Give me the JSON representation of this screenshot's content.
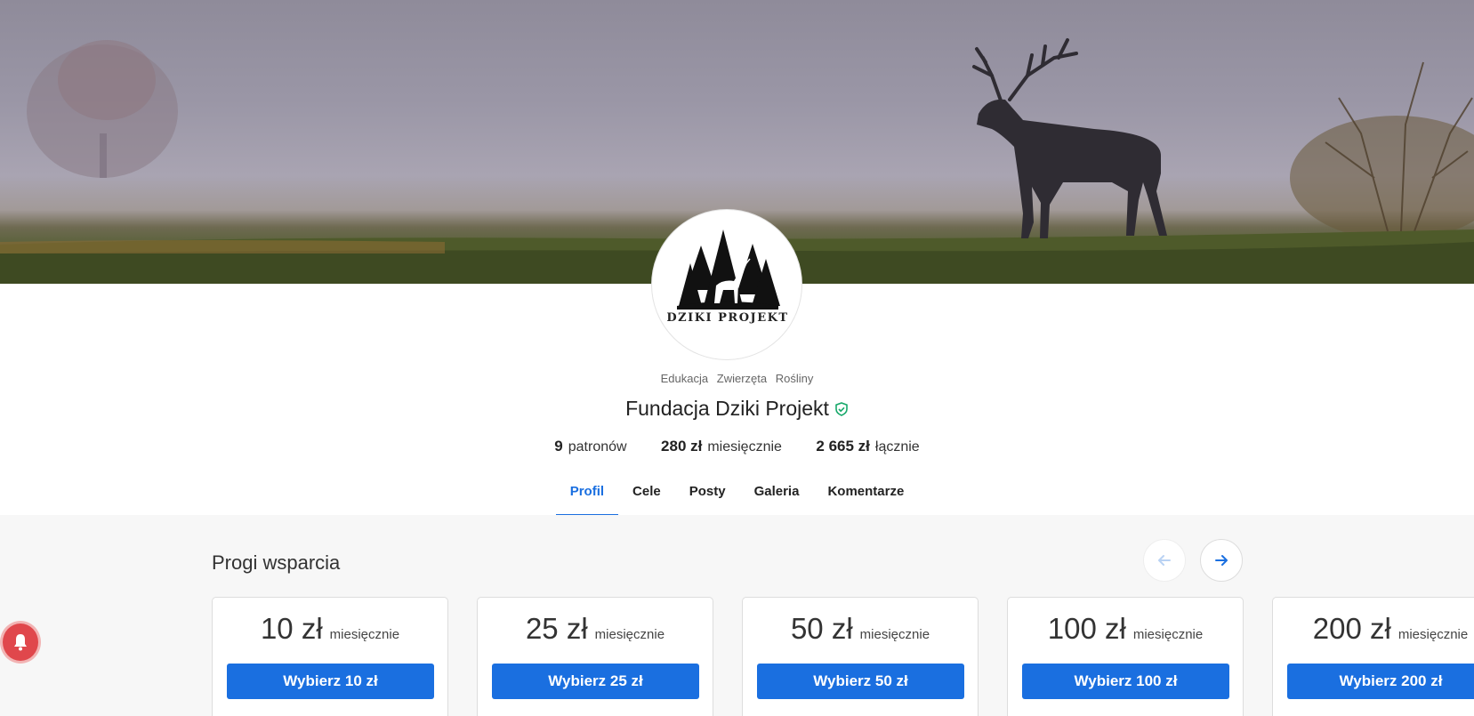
{
  "banner": {
    "alt": "deer-silhouette-banner"
  },
  "logo": {
    "text": "DZIKI PROJEKT"
  },
  "categories": [
    "Edukacja",
    "Zwierzęta",
    "Rośliny"
  ],
  "profile": {
    "name": "Fundacja Dziki Projekt",
    "verified": true,
    "verified_color": "#17a86a"
  },
  "stats": [
    {
      "value": "9",
      "label": "patronów"
    },
    {
      "value": "280 zł",
      "label": "miesięcznie"
    },
    {
      "value": "2 665 zł",
      "label": "łącznie"
    }
  ],
  "tabs": [
    {
      "label": "Profil",
      "active": true
    },
    {
      "label": "Cele",
      "active": false
    },
    {
      "label": "Posty",
      "active": false
    },
    {
      "label": "Galeria",
      "active": false
    },
    {
      "label": "Komentarze",
      "active": false
    }
  ],
  "tiers_section": {
    "title": "Progi wsparcia",
    "prev_icon": "arrow-left-icon",
    "next_icon": "arrow-right-icon"
  },
  "tiers": [
    {
      "amount": "10 zł",
      "period": "miesięcznie",
      "button": "Wybierz 10 zł"
    },
    {
      "amount": "25 zł",
      "period": "miesięcznie",
      "button": "Wybierz 25 zł"
    },
    {
      "amount": "50 zł",
      "period": "miesięcznie",
      "button": "Wybierz 50 zł"
    },
    {
      "amount": "100 zł",
      "period": "miesięcznie",
      "button": "Wybierz 100 zł"
    },
    {
      "amount": "200 zł",
      "period": "miesięcznie",
      "button": "Wybierz 200 zł"
    }
  ],
  "colors": {
    "accent": "#1a6fe0",
    "notification": "#e0474c"
  },
  "notification": {
    "icon": "bell-icon"
  }
}
